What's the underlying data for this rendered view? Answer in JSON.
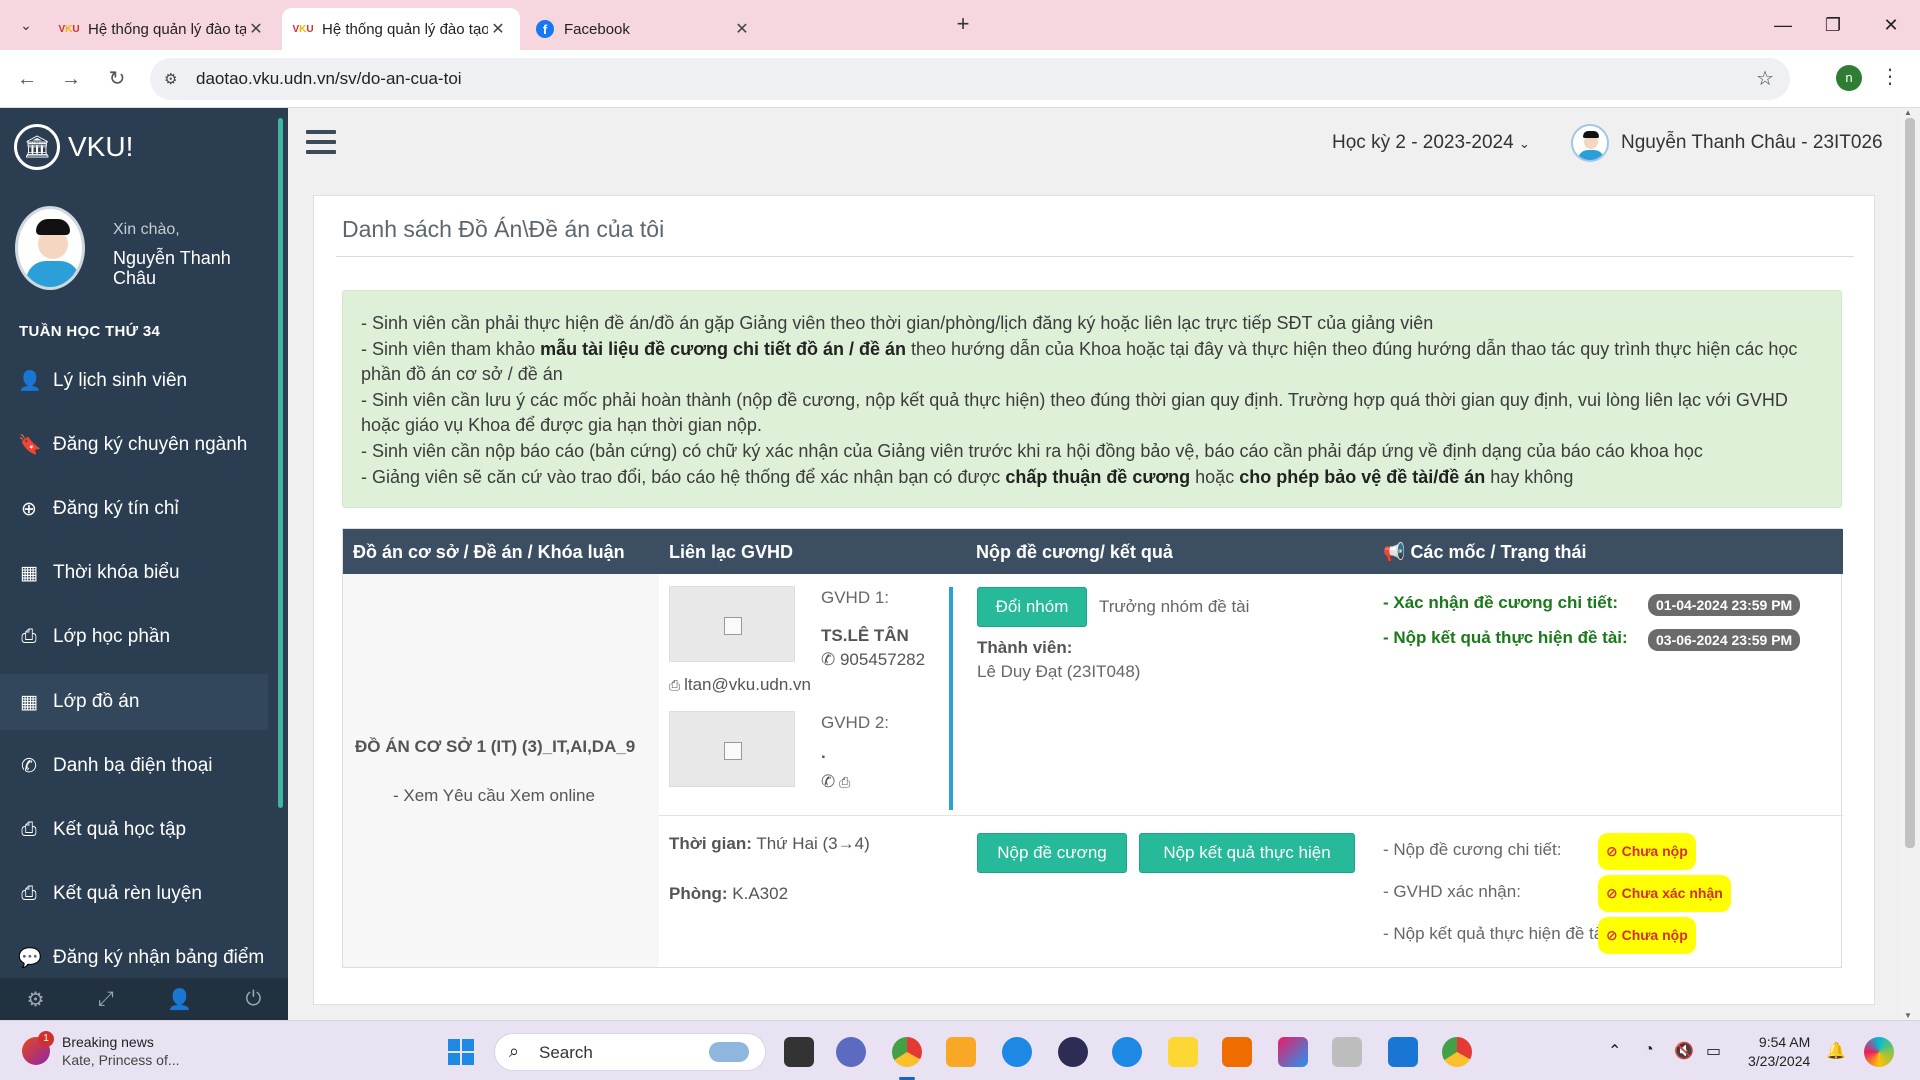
{
  "browser": {
    "tabs": [
      {
        "title": "Hệ thống quản lý đào tạo - Trườ",
        "active": false
      },
      {
        "title": "Hệ thống quản lý đào tạo - Trườ",
        "active": true
      },
      {
        "title": "Facebook",
        "active": false
      }
    ],
    "url": "daotao.vku.udn.vn/sv/do-an-cua-toi",
    "profile_initial": "n"
  },
  "sidebar": {
    "logo_text": "VKU!",
    "greeting": "Xin chào,",
    "user_name": "Nguyễn Thanh Châu",
    "week_label": "TUẦN HỌC THỨ 34",
    "items": [
      {
        "label": "Lý lịch sinh viên",
        "icon": "user-icon",
        "glyph": "👤"
      },
      {
        "label": "Đăng ký chuyên ngành",
        "icon": "bookmark-icon",
        "glyph": "🔖"
      },
      {
        "label": "Đăng ký tín chỉ",
        "icon": "plus-circle-icon",
        "glyph": "⊕"
      },
      {
        "label": "Thời khóa biểu",
        "icon": "calendar-icon",
        "glyph": "▦"
      },
      {
        "label": "Lớp học phần",
        "icon": "inbox-icon",
        "glyph": "⎙"
      },
      {
        "label": "Lớp đồ án",
        "icon": "calendar-icon",
        "glyph": "▦"
      },
      {
        "label": "Danh bạ điện thoại",
        "icon": "phone-icon",
        "glyph": "✆"
      },
      {
        "label": "Kết quả học tập",
        "icon": "print-icon",
        "glyph": "⎙"
      },
      {
        "label": "Kết quả rèn luyện",
        "icon": "print-icon",
        "glyph": "⎙"
      },
      {
        "label": "Đăng ký nhận bảng điểm",
        "icon": "comment-icon",
        "glyph": "💬"
      }
    ],
    "active_item": "Lớp đồ án"
  },
  "header": {
    "semester": "Học kỳ 2 - 2023-2024",
    "user": "Nguyễn Thanh Châu - 23IT026"
  },
  "page": {
    "title": "Danh sách Đồ Án\\Đề án của tôi",
    "notice": {
      "line1": "- Sinh viên cần phải thực hiện đề án/đồ án gặp Giảng viên theo thời gian/phòng/lịch đăng ký hoặc liên lạc trực tiếp SĐT của giảng viên",
      "line2_pre": "- Sinh viên tham khảo ",
      "line2_bold": "mẫu tài liệu đề cương chi tiết đồ án / đề án",
      "line2_post": " theo hướng dẫn của Khoa hoặc tại đây và thực hiện theo đúng hướng dẫn thao tác quy trình thực hiện các học phần đồ án cơ sở / đề án",
      "line3": "- Sinh viên cần lưu ý các mốc phải hoàn thành (nộp đề cương, nộp kết quả thực hiện) theo đúng thời gian quy định. Trường hợp quá thời gian quy định, vui lòng liên lạc với GVHD hoặc giáo vụ Khoa để được gia hạn thời gian nộp.",
      "line4": "- Sinh viên cần nộp báo cáo (bản cứng) có chữ ký xác nhận của Giảng viên trước khi ra hội đồng bảo vệ, báo cáo cần phải đáp ứng về định dạng của báo cáo khoa học",
      "line5_pre": "- Giảng viên sẽ căn cứ vào trao đổi, báo cáo hệ thống để xác nhận bạn có được ",
      "line5_bold1": "chấp thuận đề cương",
      "line5_mid": " hoặc ",
      "line5_bold2": "cho phép bảo vệ đề tài/đề án",
      "line5_post": " hay không"
    },
    "table": {
      "headers": [
        "Đồ án cơ sở / Đề án / Khóa luận",
        "Liên lạc GVHD",
        "Nộp đề cương/ kết quả",
        "Các mốc / Trạng thái"
      ],
      "project_name": "ĐỒ ÁN CƠ SỞ 1 (IT) (3)_IT,AI,DA_9",
      "project_links": "- Xem Yêu cầu Xem online",
      "gvhd1_label": "GVHD 1:",
      "gvhd1_name": "TS.LÊ TÂN",
      "gvhd1_phone": "905457282",
      "gvhd1_email": "ltan@vku.udn.vn",
      "gvhd2_label": "GVHD 2:",
      "gvhd2_name": ".",
      "change_group_button": "Đổi nhóm",
      "group_leader": "Trưởng nhóm đề tài",
      "members_label": "Thành viên:",
      "member": "Lê Duy Đạt (23IT048)",
      "milestone1_label": "- Xác nhận đề cương chi tiết:",
      "milestone1_date": "01-04-2024 23:59 PM",
      "milestone2_label": "- Nộp kết quả thực hiện đề tài:",
      "milestone2_date": "03-06-2024 23:59 PM",
      "time_label": "Thời gian:",
      "time_value": "Thứ Hai (3→4)",
      "room_label": "Phòng:",
      "room_value": "K.A302",
      "submit_outline_button": "Nộp đề cương",
      "submit_result_button": "Nộp kết quả thực hiện",
      "status1_label": "- Nộp đề cương chi tiết:",
      "status1_value": "Chưa nộp",
      "status2_label": "- GVHD xác nhận:",
      "status2_value": "Chưa xác nhận",
      "status3_label": "- Nộp kết quả thực hiện đề tài:",
      "status3_value": "Chưa nộp"
    }
  },
  "taskbar": {
    "news_title": "Breaking news",
    "news_sub": "Kate, Princess of...",
    "news_badge": "1",
    "search_placeholder": "Search",
    "time": "9:54 AM",
    "date": "3/23/2024"
  },
  "colors": {
    "sidebar_bg": "#2b3d51",
    "table_header_bg": "#3c4f62",
    "accent_green": "#26b99a",
    "notice_bg": "#dff0d8",
    "status_yellow": "#ffff00",
    "status_red": "#d32f2f"
  }
}
